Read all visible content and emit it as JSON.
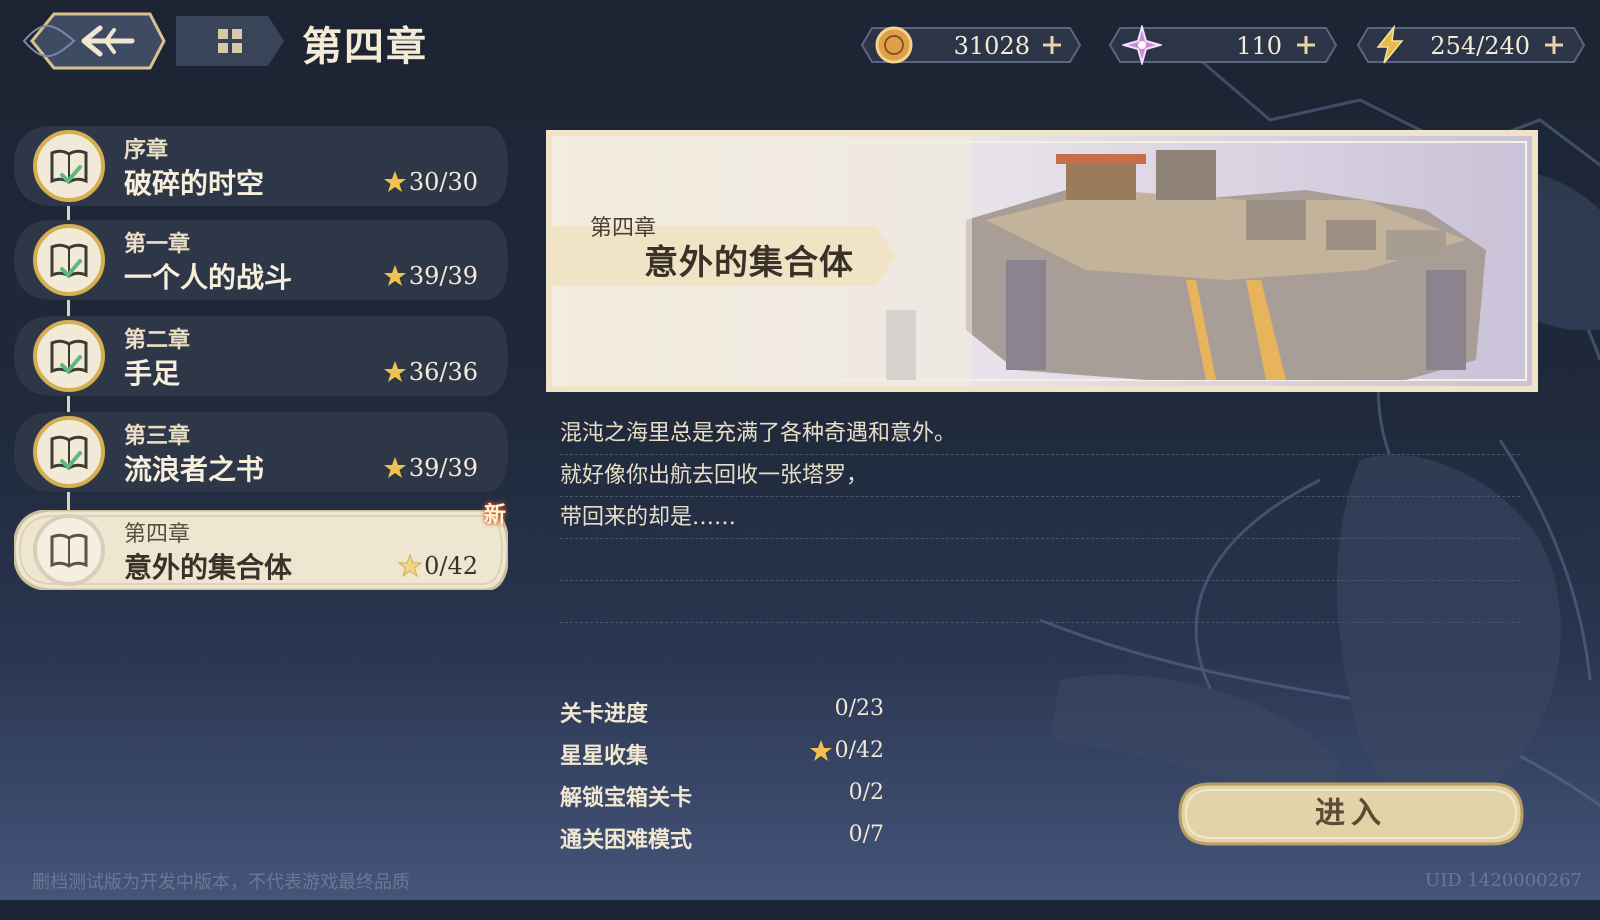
{
  "header": {
    "title": "第四章"
  },
  "resources": [
    {
      "name": "coin",
      "icon": "coin-icon",
      "value": "31028"
    },
    {
      "name": "crystal",
      "icon": "crystal-icon",
      "value": "110"
    },
    {
      "name": "energy",
      "icon": "lightning-icon",
      "value": "254/240"
    }
  ],
  "chapters": [
    {
      "sub": "序章",
      "name": "破碎的时空",
      "stars": "30/30",
      "state": "completed"
    },
    {
      "sub": "第一章",
      "name": "一个人的战斗",
      "stars": "39/39",
      "state": "completed"
    },
    {
      "sub": "第二章",
      "name": "手足",
      "stars": "36/36",
      "state": "completed"
    },
    {
      "sub": "第三章",
      "name": "流浪者之书",
      "stars": "39/39",
      "state": "completed"
    },
    {
      "sub": "第四章",
      "name": "意外的集合体",
      "stars": "0/42",
      "state": "selected",
      "badge": "新"
    }
  ],
  "banner": {
    "subtitle": "第四章",
    "title": "意外的集合体"
  },
  "description": [
    "混沌之海里总是充满了各种奇遇和意外。",
    "就好像你出航去回收一张塔罗，",
    "带回来的却是……",
    "",
    ""
  ],
  "stats": [
    {
      "label": "关卡进度",
      "value": "0/23"
    },
    {
      "label": "星星收集",
      "value": "0/42",
      "star": true
    },
    {
      "label": "解锁宝箱关卡",
      "value": "0/2"
    },
    {
      "label": "通关困难模式",
      "value": "0/7"
    }
  ],
  "enter_button": "进入",
  "footer": {
    "notice": "删档测试版为开发中版本，不代表游戏最终品质",
    "uid": "UID 1420000267"
  },
  "colors": {
    "background_dark": "#1c2433",
    "panel_dark": "#2c3547",
    "gold": "#d9b25a",
    "cream": "#efe6d2",
    "star": "#f2c14e"
  }
}
